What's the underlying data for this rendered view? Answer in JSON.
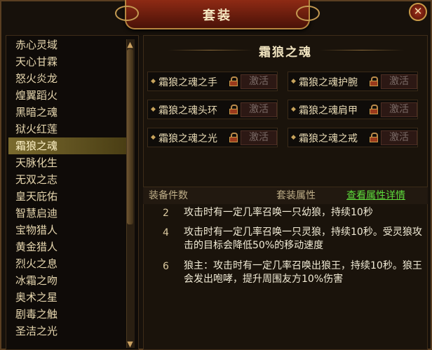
{
  "window": {
    "title": "套装",
    "close_icon": "close-icon"
  },
  "set_list": {
    "items": [
      "赤心灵域",
      "天心甘霖",
      "怒火炎龙",
      "煌翼蹈火",
      "黑暗之魂",
      "狱火红莲",
      "霜狼之魂",
      "天脉化生",
      "无双之志",
      "皇天庇佑",
      "智慧启迪",
      "宝物猎人",
      "黄金猎人",
      "烈火之息",
      "冰霜之吻",
      "奥术之星",
      "剧毒之触",
      "圣洁之光"
    ],
    "selected": "霜狼之魂"
  },
  "detail": {
    "set_name": "霜狼之魂",
    "pieces": [
      {
        "name": "霜狼之魂之手",
        "button": "激活"
      },
      {
        "name": "霜狼之魂护腕",
        "button": "激活"
      },
      {
        "name": "霜狼之魂头环",
        "button": "激活"
      },
      {
        "name": "霜狼之魂肩甲",
        "button": "激活"
      },
      {
        "name": "霜狼之魂之光",
        "button": "激活"
      },
      {
        "name": "霜狼之魂之戒",
        "button": "激活"
      }
    ],
    "header": {
      "count": "装备件数",
      "attributes": "套装属性",
      "details_link": "查看属性详情"
    },
    "bonuses": [
      {
        "count": "2",
        "text": "攻击时有一定几率召唤一只幼狼，持续10秒"
      },
      {
        "count": "4",
        "text": "攻击时有一定几率召唤一只灵狼，持续10秒。受灵狼攻击的目标会降低50%的移动速度"
      },
      {
        "count": "6",
        "text": "狼主：攻击时有一定几率召唤出狼王，持续10秒。狼王会发出咆哮，提升周围友方10%伤害"
      }
    ]
  },
  "colors": {
    "accent_green": "#5edc3c",
    "selected_bg": "#7a6a2e",
    "title_red": "#8e2a14"
  }
}
